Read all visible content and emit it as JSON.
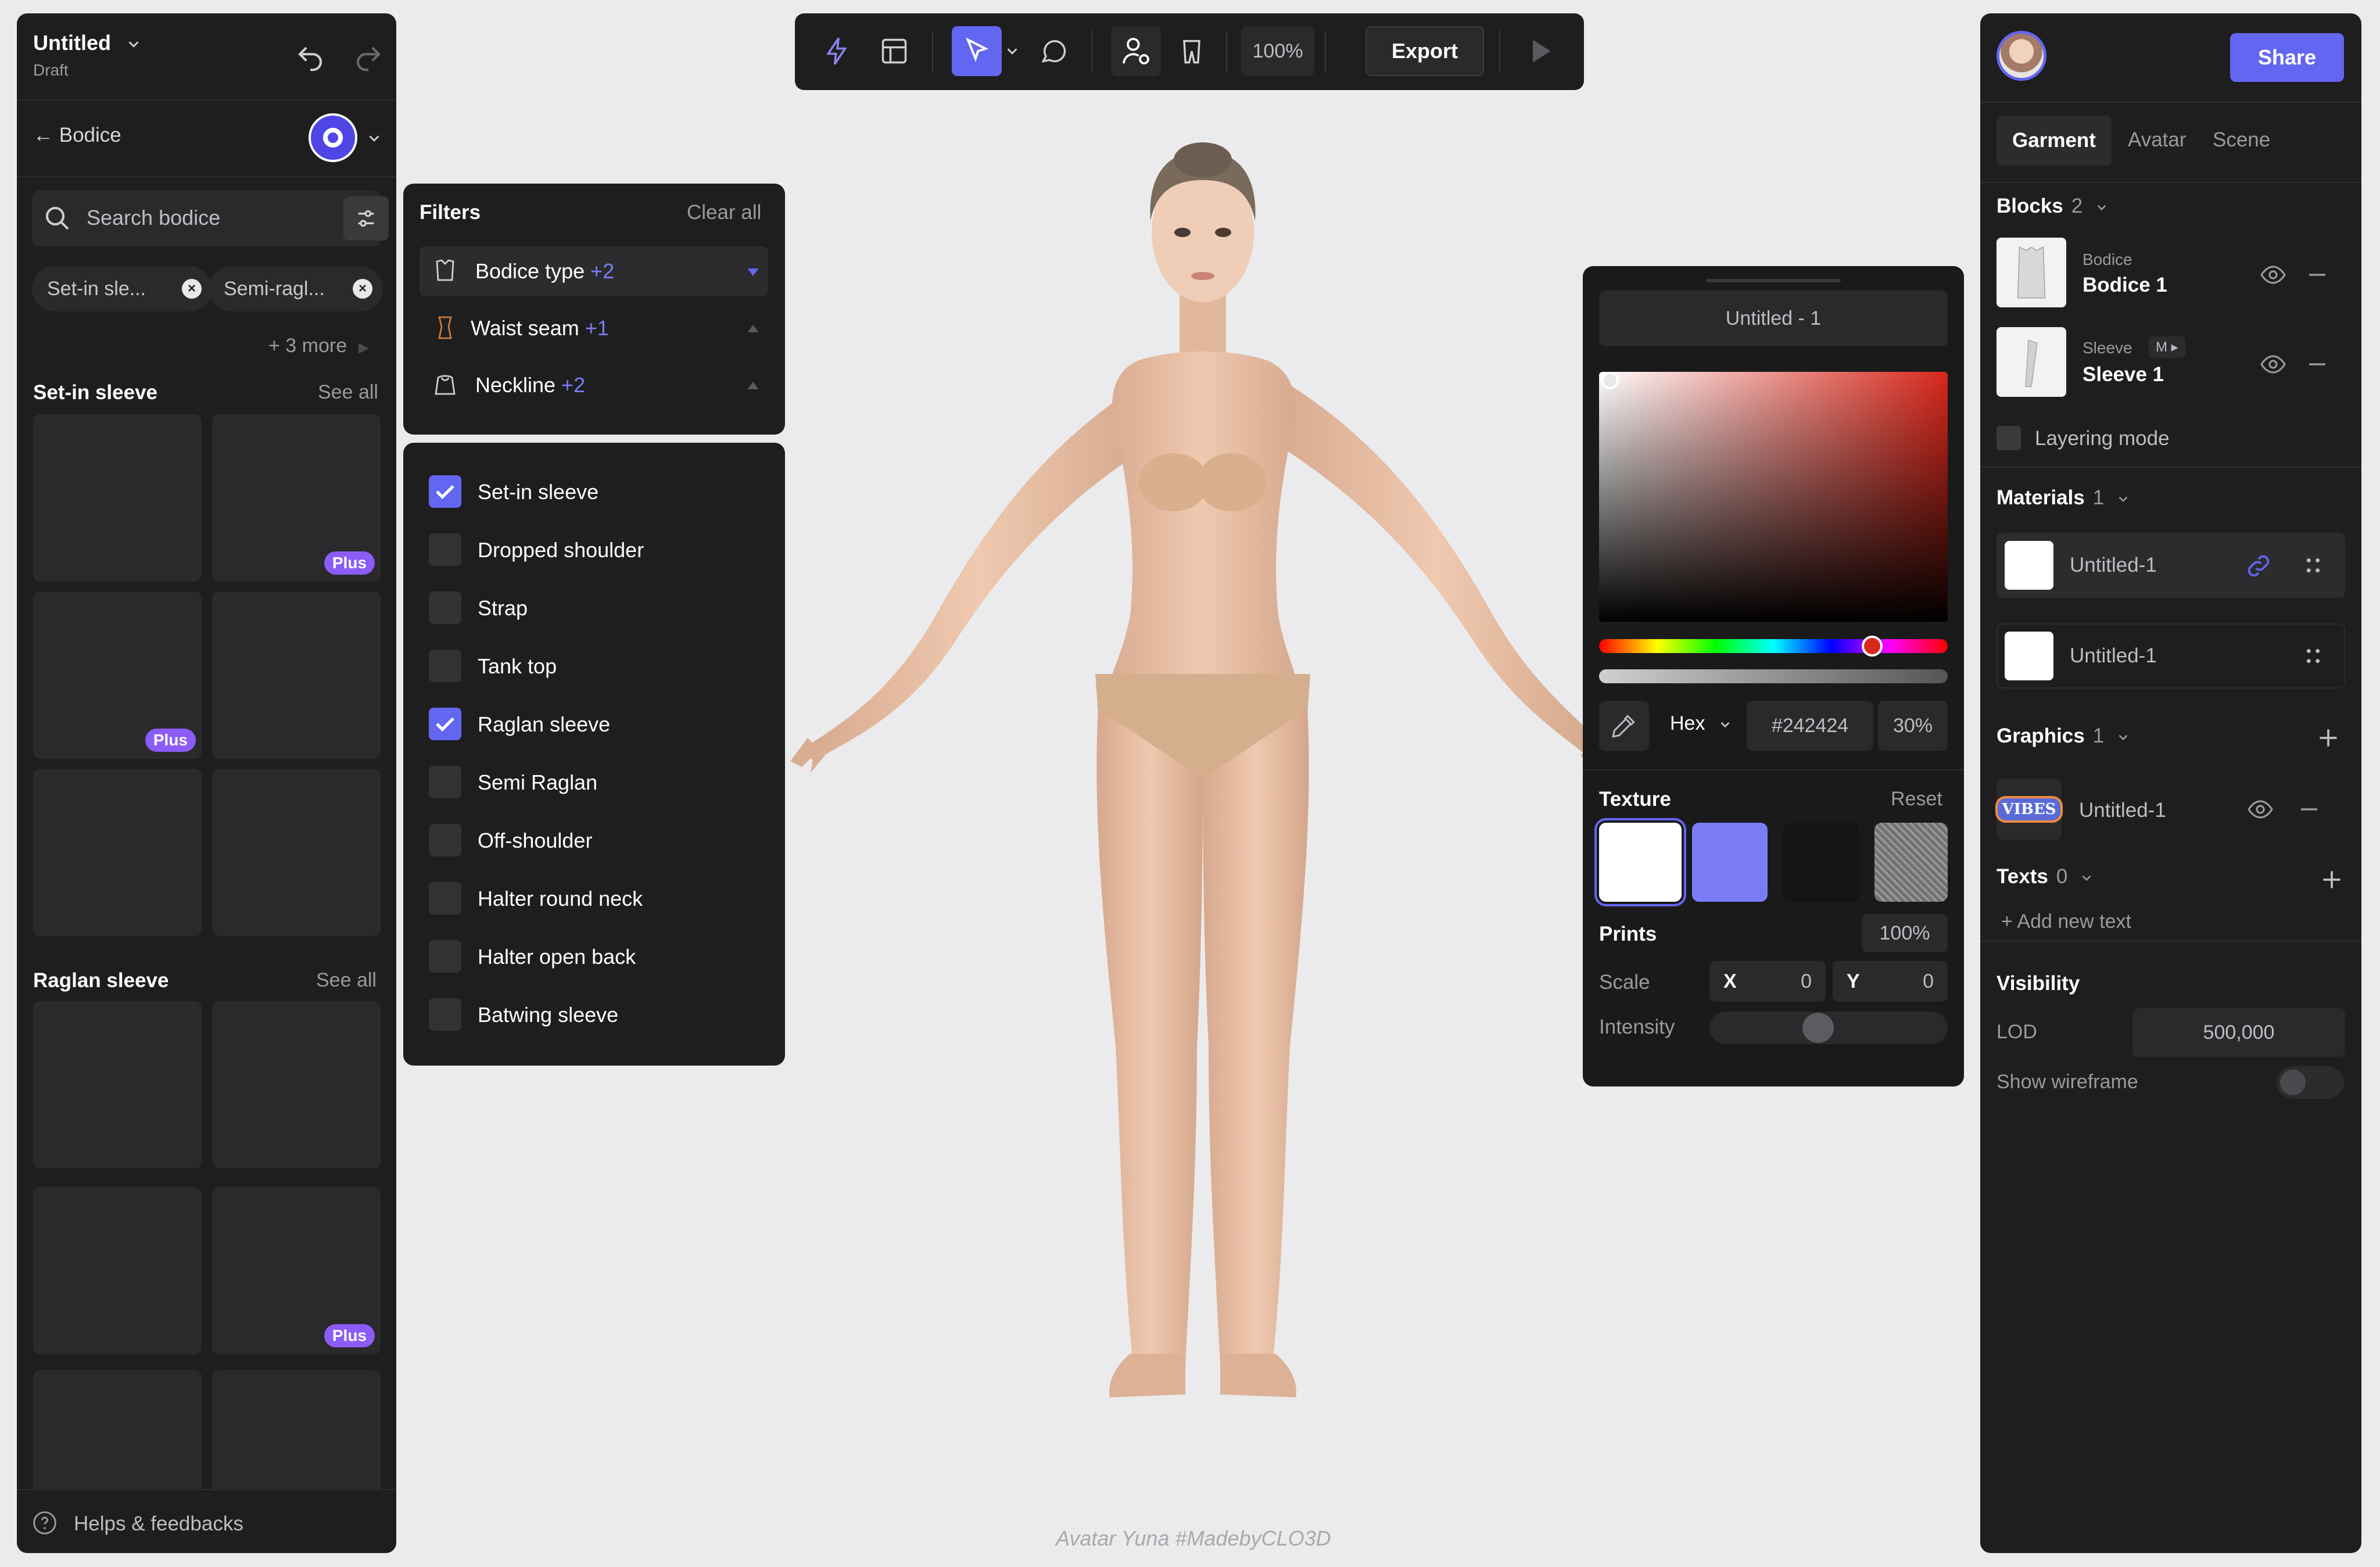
{
  "document": {
    "title": "Untitled",
    "status": "Draft"
  },
  "left_panel": {
    "back_label": "← Bodice",
    "search_placeholder": "Search bodice",
    "chips": [
      "Set-in sle...",
      "Semi-ragl..."
    ],
    "more_label": "+ 3 more",
    "sections": [
      {
        "title": "Set-in sleeve",
        "see_all": "See all",
        "badges": [
          "Plus",
          "Plus"
        ]
      },
      {
        "title": "Raglan sleeve",
        "see_all": "See all",
        "badges": [
          "Plus"
        ]
      }
    ],
    "help_label": "Helps & feedbacks"
  },
  "toolbar": {
    "zoom": "100%",
    "export_label": "Export",
    "icons": [
      "lightning-icon",
      "layout-icon",
      "select-arrow-icon",
      "chevron-down-icon",
      "comment-icon",
      "avatar-settings-icon",
      "garment-icon",
      "play-icon"
    ]
  },
  "filters": {
    "title": "Filters",
    "clear_all": "Clear all",
    "groups": [
      {
        "label": "Bodice type",
        "count": "+2",
        "expanded": true
      },
      {
        "label": "Waist seam",
        "count": "+1",
        "expanded": false
      },
      {
        "label": "Neckline",
        "count": "+2",
        "expanded": false
      }
    ],
    "options": [
      {
        "label": "Set-in sleeve",
        "checked": true
      },
      {
        "label": "Dropped shoulder",
        "checked": false
      },
      {
        "label": "Strap",
        "checked": false
      },
      {
        "label": "Tank top",
        "checked": false
      },
      {
        "label": "Raglan sleeve",
        "checked": true
      },
      {
        "label": "Semi Raglan",
        "checked": false
      },
      {
        "label": "Off-shoulder",
        "checked": false
      },
      {
        "label": "Halter round neck",
        "checked": false
      },
      {
        "label": "Halter open back",
        "checked": false
      },
      {
        "label": "Batwing sleeve",
        "checked": false
      }
    ]
  },
  "color_picker": {
    "name": "Untitled - 1",
    "mode": "Hex",
    "hex": "#242424",
    "opacity": "30%",
    "hue_color": "#d8281c",
    "texture_title": "Texture",
    "reset_label": "Reset",
    "textures": [
      "#ffffff",
      "#7b7cf5",
      "#161412",
      "noise"
    ],
    "prints_title": "Prints",
    "prints_value": "100%",
    "scale_label": "Scale",
    "scale_x_label": "X",
    "scale_x": "0",
    "scale_y_label": "Y",
    "scale_y": "0",
    "intensity_label": "Intensity",
    "intensity": 0.45
  },
  "right_panel": {
    "share_label": "Share",
    "tabs": [
      "Garment",
      "Avatar",
      "Scene"
    ],
    "active_tab": "Garment",
    "blocks_title": "Blocks",
    "blocks_count": "2",
    "blocks": [
      {
        "type": "Bodice",
        "name": "Bodice 1"
      },
      {
        "type": "Sleeve",
        "tag": "M ▸",
        "name": "Sleeve 1"
      }
    ],
    "layering_label": "Layering mode",
    "materials_title": "Materials",
    "materials_count": "1",
    "materials": [
      "Untitled-1",
      "Untitled-1"
    ],
    "graphics_title": "Graphics",
    "graphics_count": "1",
    "graphics": [
      {
        "name": "Untitled-1",
        "art_text": "VIBES"
      }
    ],
    "texts_title": "Texts",
    "texts_count": "0",
    "add_text_label": "+ Add  new text",
    "visibility_title": "Visibility",
    "lod_label": "LOD",
    "lod_value": "500,000",
    "wireframe_label": "Show wireframe",
    "wireframe_on": false
  },
  "viewport": {
    "caption": "Avatar Yuna #MadebyCLO3D"
  },
  "colors": {
    "accent": "#6366f1",
    "panel": "#1e1e1f",
    "plus_badge": "#8b5cf6",
    "canvas": "#ebebed"
  }
}
